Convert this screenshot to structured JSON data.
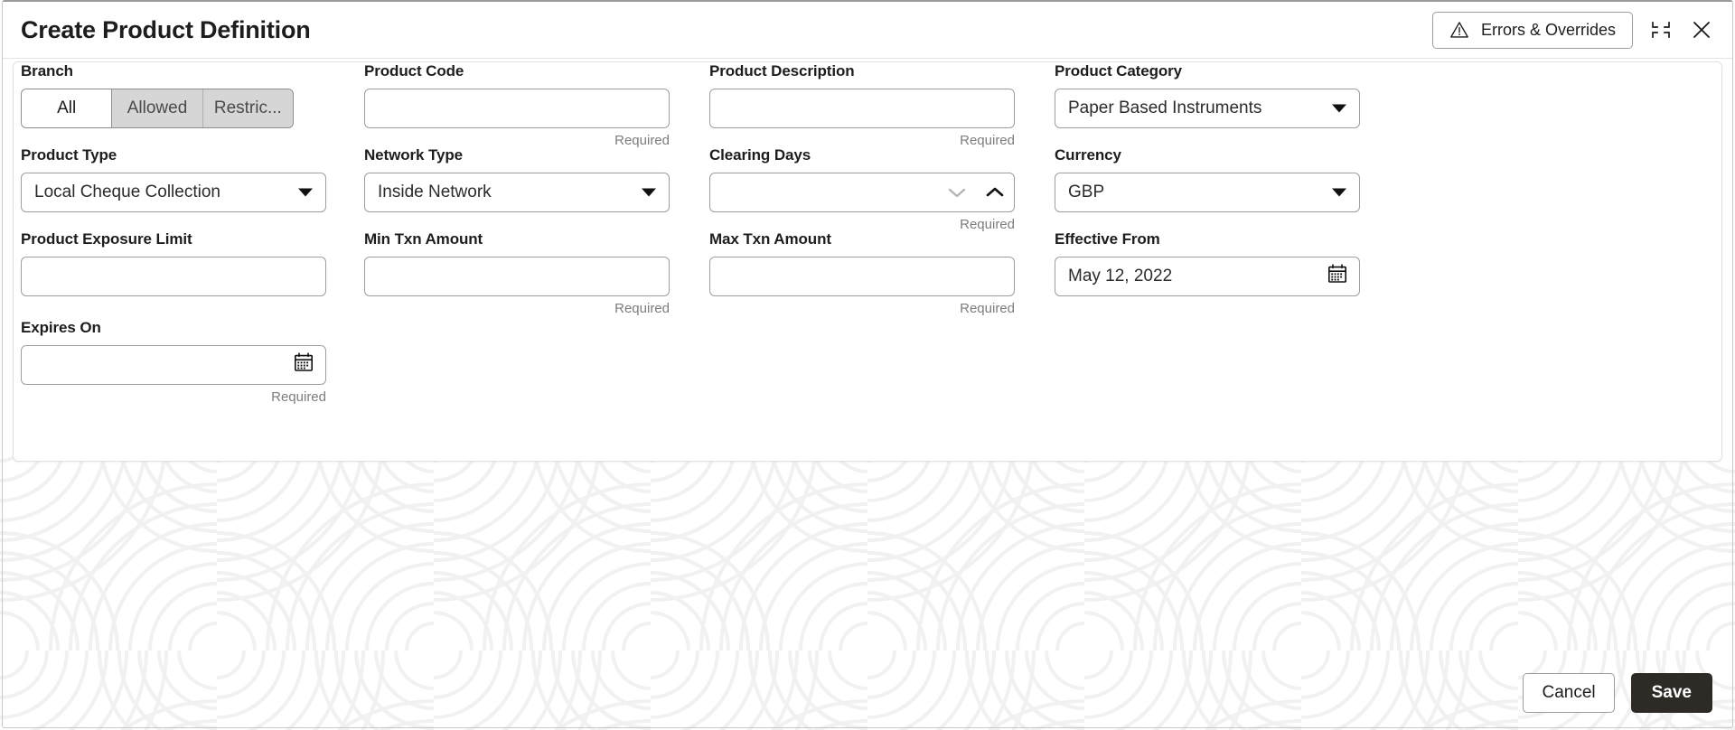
{
  "window": {
    "title": "Create Product Definition",
    "errors_overrides_label": "Errors & Overrides",
    "warning_icon": "warning-triangle-icon",
    "maximize_icon": "maximize-icon",
    "close_icon": "close-icon"
  },
  "form": {
    "branch": {
      "label": "Branch",
      "options": [
        "All",
        "Allowed",
        "Restric..."
      ],
      "selected_index": 0
    },
    "product_code": {
      "label": "Product Code",
      "value": "",
      "placeholder": "",
      "helper": "Required"
    },
    "product_description": {
      "label": "Product Description",
      "value": "",
      "placeholder": "",
      "helper": "Required"
    },
    "product_category": {
      "label": "Product Category",
      "value": "Paper Based Instruments",
      "helper": ""
    },
    "product_type": {
      "label": "Product Type",
      "value": "Local Cheque Collection",
      "helper": ""
    },
    "network_type": {
      "label": "Network Type",
      "value": "Inside Network",
      "helper": ""
    },
    "clearing_days": {
      "label": "Clearing Days",
      "value": "",
      "helper": "Required",
      "decrement_icon": "chevron-down-icon",
      "increment_icon": "chevron-up-icon"
    },
    "currency": {
      "label": "Currency",
      "value": "GBP",
      "helper": ""
    },
    "product_exposure_limit": {
      "label": "Product Exposure Limit",
      "value": "",
      "placeholder": "",
      "helper": ""
    },
    "min_txn_amount": {
      "label": "Min Txn Amount",
      "value": "",
      "placeholder": "",
      "helper": "Required"
    },
    "max_txn_amount": {
      "label": "Max Txn Amount",
      "value": "",
      "placeholder": "",
      "helper": "Required"
    },
    "effective_from": {
      "label": "Effective From",
      "value": "May 12, 2022",
      "helper": "",
      "calendar_icon": "calendar-icon"
    },
    "expires_on": {
      "label": "Expires On",
      "value": "",
      "helper": "Required",
      "calendar_icon": "calendar-icon"
    }
  },
  "footer": {
    "cancel_label": "Cancel",
    "save_label": "Save"
  },
  "colors": {
    "save_button_bg": "#2E2A26",
    "border": "#9E9E9E",
    "helper_text": "#7D7D7D",
    "segment_inactive_bg": "#D6D6D6",
    "watermark": "#F2F2F2"
  }
}
